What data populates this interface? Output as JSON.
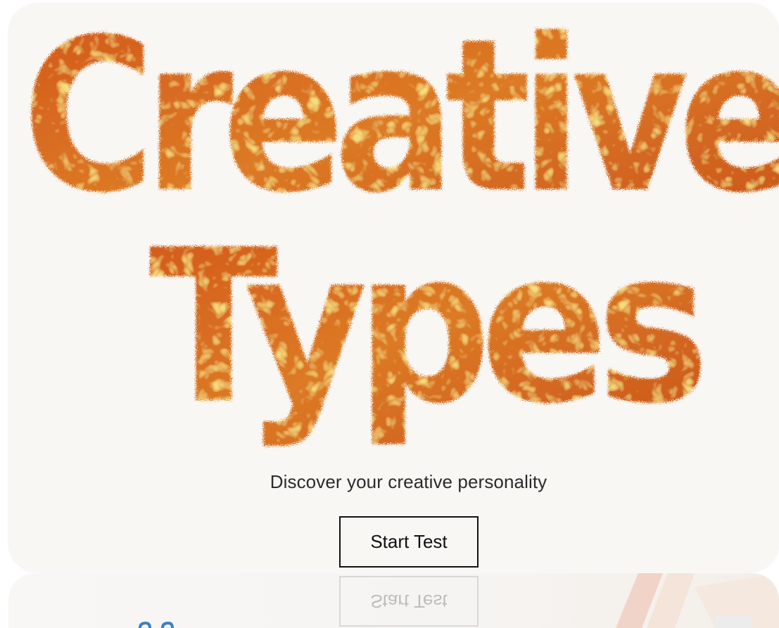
{
  "hero": {
    "title_line1": "Creative",
    "title_line2": "Types"
  },
  "tagline": "Discover your creative personality",
  "start_button_label": "Start Test",
  "reflection": {
    "button_label": "Start Test"
  },
  "colors": {
    "card_background": "#f9f7f4",
    "fur_orange": "#d9621d",
    "fur_yellow": "#e6b834",
    "button_border": "#111111",
    "accent_blue": "#3d7fc4"
  }
}
